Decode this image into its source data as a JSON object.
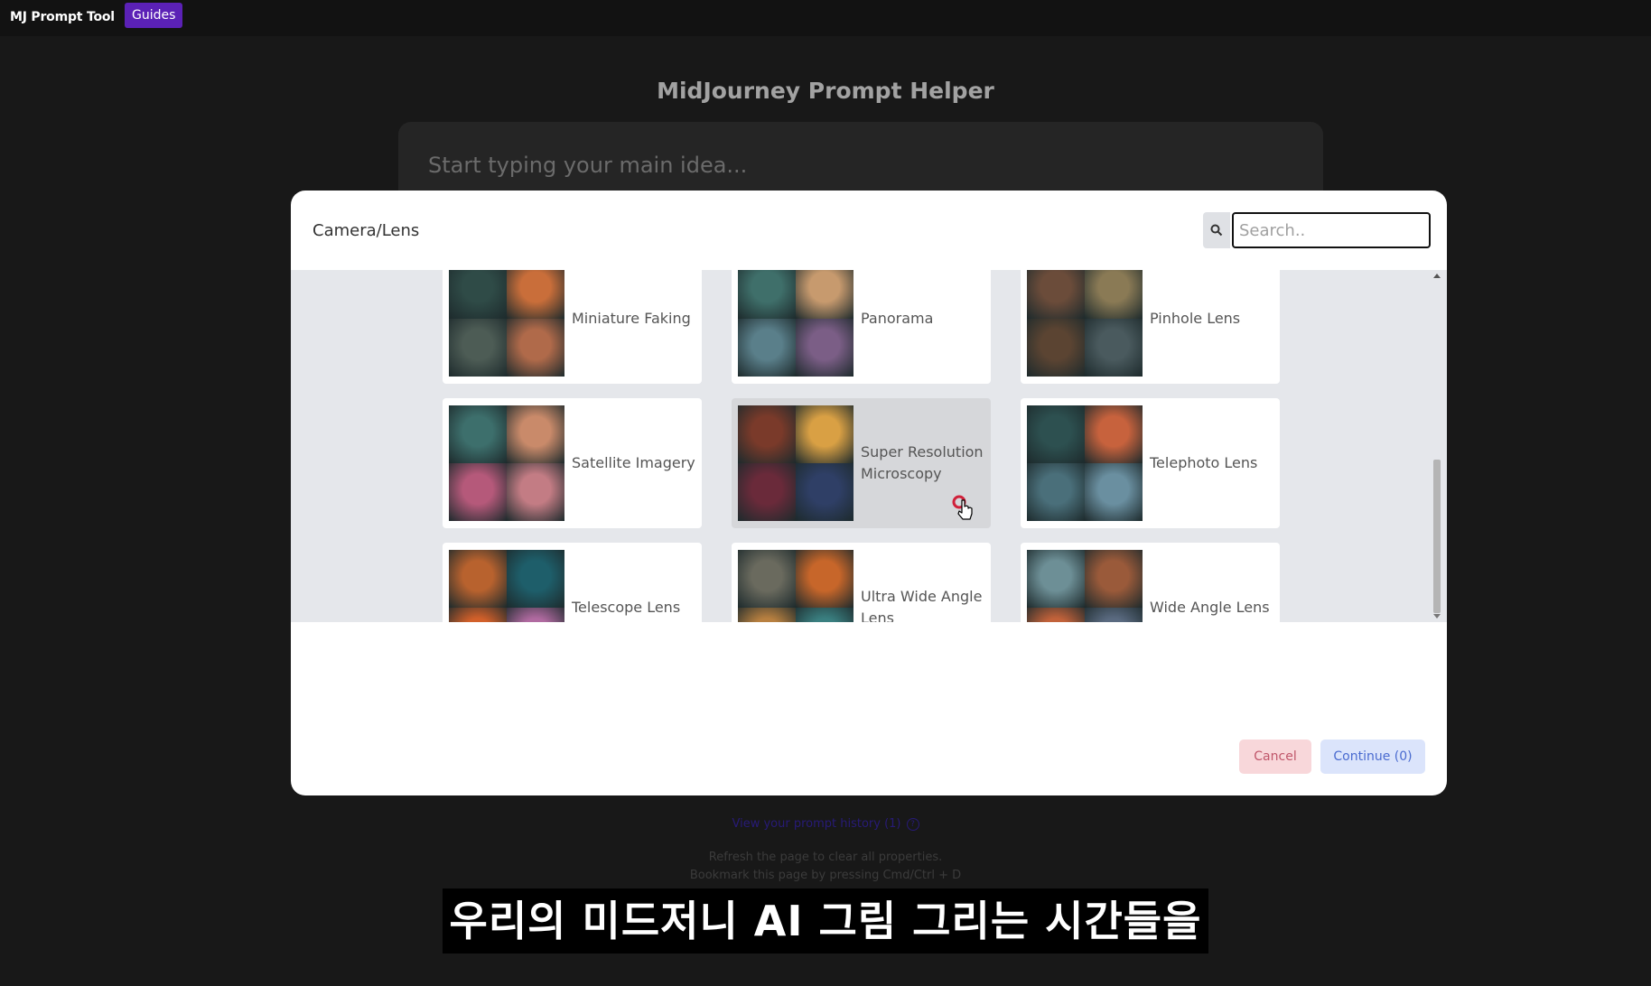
{
  "topbar": {
    "brand": "MJ Prompt Tool",
    "guides_label": "Guides"
  },
  "background": {
    "title": "MidJourney Prompt Helper",
    "idea_placeholder": "Start typing your main idea...",
    "history_link": "View your prompt history (1)",
    "note_refresh": "Refresh the page to clear all properties.",
    "note_bookmark": "Bookmark this page by pressing Cmd/Ctrl + D"
  },
  "modal": {
    "title": "Camera/Lens",
    "search_icon": "search-icon",
    "search_placeholder": "Search..",
    "cards": [
      {
        "label": "Miniature Faking",
        "colors": [
          "#2f4b47",
          "#c96e3a",
          "#4d5c55",
          "#b06a4a"
        ]
      },
      {
        "label": "Panorama",
        "colors": [
          "#3f6f6a",
          "#c79a6e",
          "#5a7f8a",
          "#7b5e86"
        ]
      },
      {
        "label": "Pinhole Lens",
        "colors": [
          "#6b4c3a",
          "#8a7a55",
          "#5b4432",
          "#4a5a5e"
        ]
      },
      {
        "label": "Satellite Imagery",
        "colors": [
          "#3d6f6c",
          "#c98a6a",
          "#b5597a",
          "#c37c84"
        ]
      },
      {
        "label": "Super Resolution Microscopy",
        "colors": [
          "#7a3a2a",
          "#d9a044",
          "#6a2a3a",
          "#2f3f66"
        ]
      },
      {
        "label": "Telephoto Lens",
        "colors": [
          "#2d5050",
          "#c7623d",
          "#4a6f7a",
          "#6a8fa0"
        ]
      },
      {
        "label": "Telescope Lens",
        "colors": [
          "#b8622e",
          "#1e5e6a",
          "#d2602a",
          "#b06aa0"
        ]
      },
      {
        "label": "Ultra Wide Angle Lens",
        "colors": [
          "#6a6a5e",
          "#c7662a",
          "#b88040",
          "#3a7f80"
        ]
      },
      {
        "label": "Wide Angle Lens",
        "colors": [
          "#6d8f96",
          "#9a5a3a",
          "#c2623a",
          "#5a6a80"
        ]
      }
    ],
    "cancel_label": "Cancel",
    "continue_label": "Continue (0)"
  },
  "subtitle": "우리의 미드저니 AI 그림 그리는 시간들을"
}
